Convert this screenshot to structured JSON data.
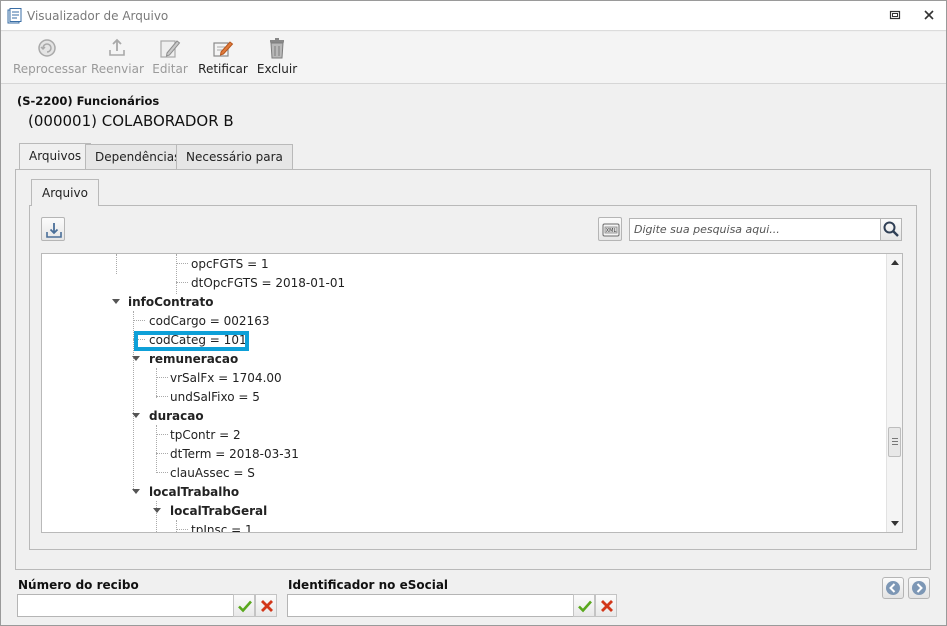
{
  "window": {
    "title": "Visualizador de Arquivo"
  },
  "toolbar": {
    "reprocess_label": "Reprocessar",
    "resend_label": "Reenviar",
    "edit_label": "Editar",
    "rectify_label": "Retificar",
    "delete_label": "Excluir"
  },
  "header": {
    "event_title": "(S-2200) Funcionários",
    "employee": "(000001) COLABORADOR B"
  },
  "tabs": [
    {
      "label": "Arquivos",
      "active": true
    },
    {
      "label": "Dependências",
      "active": false
    },
    {
      "label": "Necessário para",
      "active": false
    }
  ],
  "inner_tab": {
    "label": "Arquivo"
  },
  "search": {
    "placeholder": "Digite sua pesquisa aqui..."
  },
  "tree": {
    "nodes": [
      {
        "label": "opcFGTS = 1"
      },
      {
        "label": "dtOpcFGTS = 2018-01-01"
      },
      {
        "label": "infoContrato"
      },
      {
        "label": "codCargo = 002163"
      },
      {
        "label": "codCateg = 101",
        "highlighted": true
      },
      {
        "label": "remuneracao"
      },
      {
        "label": "vrSalFx = 1704.00"
      },
      {
        "label": "undSalFixo = 5"
      },
      {
        "label": "duracao"
      },
      {
        "label": "tpContr = 2"
      },
      {
        "label": "dtTerm = 2018-03-31"
      },
      {
        "label": "clauAssec = S"
      },
      {
        "label": "localTrabalho"
      },
      {
        "label": "localTrabGeral"
      },
      {
        "label": "tpInsc = 1"
      }
    ],
    "highlight_color": "#0ea0d8"
  },
  "fields": {
    "receipt_label": "Número do recibo",
    "receipt_value": "",
    "esocial_id_label": "Identificador no eSocial",
    "esocial_id_value": ""
  },
  "colors": {
    "confirm": "#5aa81e",
    "cancel": "#d2371a",
    "nav": "#6f8fb0"
  }
}
